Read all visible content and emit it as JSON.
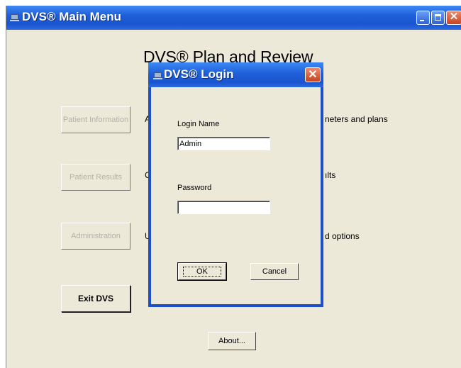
{
  "main_window": {
    "title": "DVS® Main Menu",
    "heading": "DVS® Plan and Review",
    "buttons": {
      "patient_information": "Patient Information",
      "patient_results": "Patient Results",
      "administration": "Administration",
      "exit": "Exit DVS",
      "about": "About..."
    },
    "descriptions": {
      "row1_left": "A",
      "row1_right": "neters and plans",
      "row2_left": "C",
      "row2_right": "ılts",
      "row3_left": "U",
      "row3_right": "d options"
    }
  },
  "login_dialog": {
    "title": "DVS® Login",
    "login_name_label": "Login Name",
    "login_name_value": "Admin",
    "password_label": "Password",
    "password_value": "",
    "ok_label": "OK",
    "cancel_label": "Cancel"
  },
  "colors": {
    "titlebar": "#1f5fd8",
    "window_bg": "#ece9d8",
    "close_button": "#d9532c"
  }
}
